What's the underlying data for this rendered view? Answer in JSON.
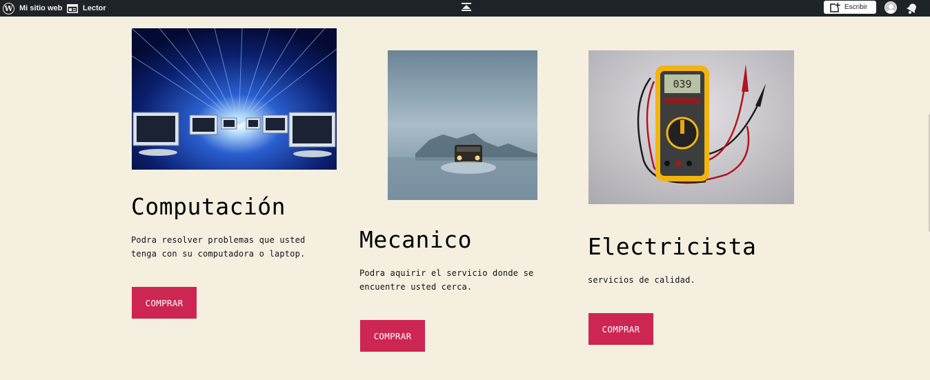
{
  "adminbar": {
    "site_label": "Mi sitio web",
    "reader_label": "Lector",
    "write_label": "Escribir"
  },
  "cards": [
    {
      "title": "Computación",
      "description": "Podra resolver problemas que usted tenga con su computadora o laptop.",
      "button": "COMPRAR",
      "image": "computer-data-tunnel-image"
    },
    {
      "title": "Mecanico",
      "description": "Podra aquirir el servicio donde se encuentre usted cerca.",
      "button": "COMPRAR",
      "image": "truck-in-fog-image"
    },
    {
      "title": "Electricista",
      "description": "servicios de calidad.",
      "button": "COMPRAR",
      "image": "multimeter-image"
    }
  ],
  "colors": {
    "background": "#f5efe0",
    "adminbar": "#1d2327",
    "button": "#cd2653"
  }
}
